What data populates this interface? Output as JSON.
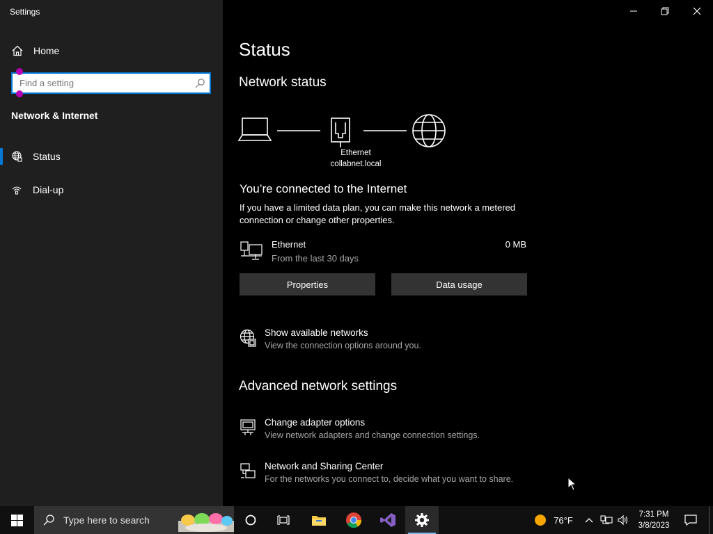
{
  "window": {
    "title": "Settings"
  },
  "sidebar": {
    "home_label": "Home",
    "search_placeholder": "Find a setting",
    "section_title": "Network & Internet",
    "items": [
      {
        "label": "Status",
        "icon": "globe-icon",
        "active": true
      },
      {
        "label": "Dial-up",
        "icon": "dial-up-icon",
        "active": false
      }
    ]
  },
  "main": {
    "title": "Status",
    "network_status_heading": "Network status",
    "diagram": {
      "adapter_name": "Ethernet",
      "domain": "collabnet.local"
    },
    "connected_text": "You’re connected to the Internet",
    "connected_desc": "If you have a limited data plan, you can make this network a metered connection or change other properties.",
    "ethernet": {
      "name": "Ethernet",
      "period": "From the last 30 days",
      "usage": "0 MB"
    },
    "buttons": {
      "properties": "Properties",
      "data_usage": "Data usage"
    },
    "show_networks": {
      "title": "Show available networks",
      "desc": "View the connection options around you."
    },
    "advanced_heading": "Advanced network settings",
    "advanced_items": [
      {
        "title": "Change adapter options",
        "desc": "View network adapters and change connection settings."
      },
      {
        "title": "Network and Sharing Center",
        "desc": "For the networks you connect to, decide what you want to share."
      }
    ]
  },
  "taskbar": {
    "search_placeholder": "Type here to search",
    "weather_temp": "76°F",
    "time": "7:31 PM",
    "date": "3/8/2023"
  },
  "colors": {
    "accent": "#0078d4",
    "sidebar_bg": "#1f1f1f",
    "main_bg": "#000000",
    "button_bg": "#333333"
  }
}
